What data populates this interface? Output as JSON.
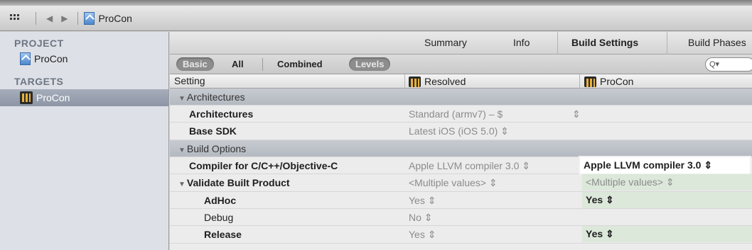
{
  "pathbar": {
    "crumb": "ProCon"
  },
  "sidebar": {
    "project_header": "PROJECT",
    "project_item": "ProCon",
    "targets_header": "TARGETS",
    "target_item": "ProCon"
  },
  "tabs": [
    "Summary",
    "Info",
    "Build Settings",
    "Build Phases"
  ],
  "filters": {
    "basic": "Basic",
    "all": "All",
    "combined": "Combined",
    "levels": "Levels",
    "search_icon": "Q▾"
  },
  "columns": {
    "setting": "Setting",
    "resolved": "Resolved",
    "procon": "ProCon"
  },
  "rows": [
    {
      "type": "group",
      "label": "Architectures"
    },
    {
      "type": "setting",
      "label": "Architectures",
      "resolved": "Standard (armv7)  –  $",
      "extra": "⇕",
      "procon": ""
    },
    {
      "type": "setting",
      "label": "Base SDK",
      "resolved": "Latest iOS (iOS 5.0) ⇕",
      "procon": ""
    },
    {
      "type": "group",
      "label": "Build Options"
    },
    {
      "type": "setting",
      "label": "Compiler for C/C++/Objective-C",
      "resolved": "Apple LLVM compiler 3.0 ⇕",
      "procon": "Apple LLVM compiler 3.0 ⇕"
    },
    {
      "type": "setting",
      "label": "Validate Built Product",
      "resolved": "<Multiple values> ⇕",
      "procon": "<Multiple values> ⇕"
    },
    {
      "type": "sub",
      "label": "AdHoc",
      "resolved": "Yes ⇕",
      "procon": "Yes ⇕"
    },
    {
      "type": "sub",
      "label": "Debug",
      "resolved": "No ⇕",
      "procon": ""
    },
    {
      "type": "sub",
      "label": "Release",
      "resolved": "Yes ⇕",
      "procon": "Yes ⇕"
    }
  ]
}
